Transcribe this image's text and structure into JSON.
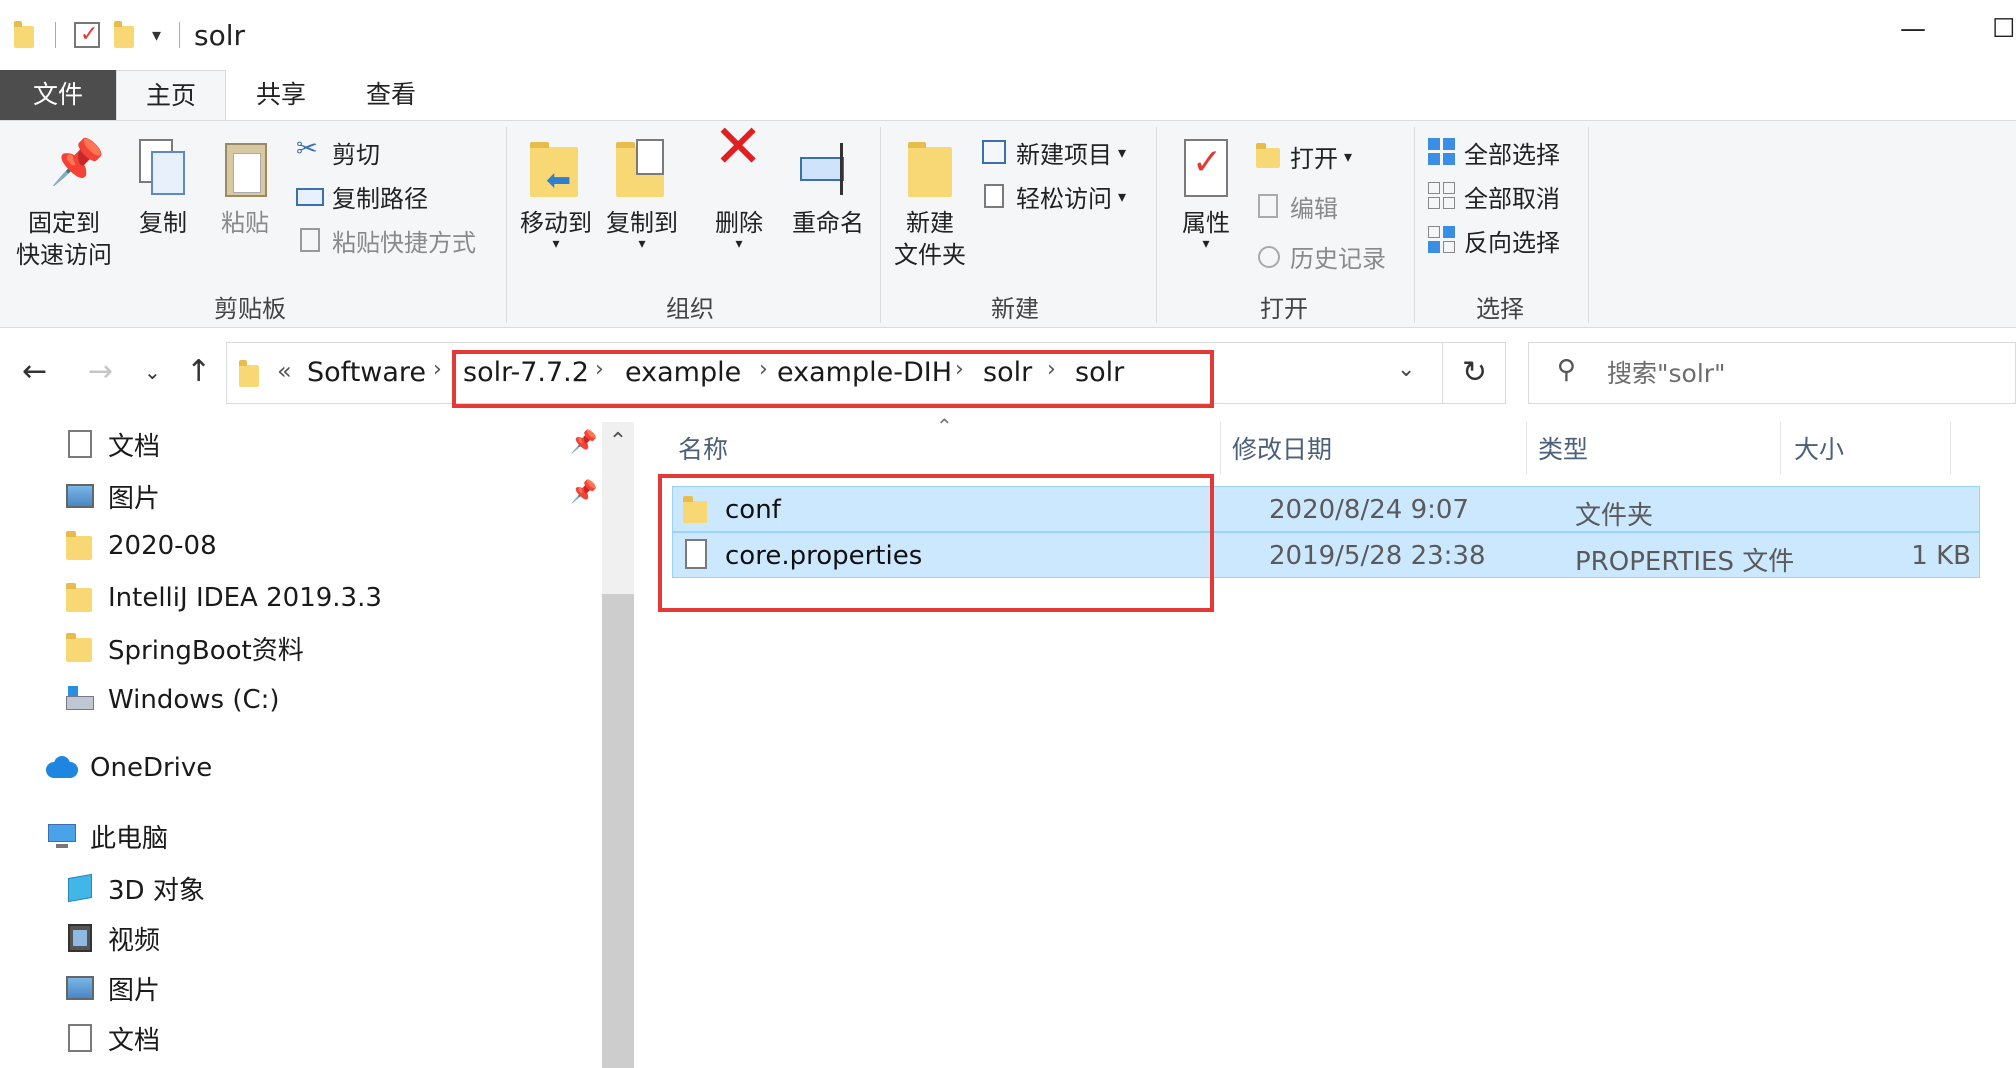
{
  "window": {
    "title": "solr",
    "minimize": "—",
    "maximize": "☐"
  },
  "tabs": [
    {
      "label": "文件"
    },
    {
      "label": "主页"
    },
    {
      "label": "共享"
    },
    {
      "label": "查看"
    }
  ],
  "ribbon": {
    "clipboard": {
      "group": "剪贴板",
      "pin_line1": "固定到",
      "pin_line2": "快速访问",
      "copy": "复制",
      "paste": "粘贴",
      "cut": "剪切",
      "copy_path": "复制路径",
      "paste_shortcut": "粘贴快捷方式"
    },
    "organize": {
      "group": "组织",
      "move_to": "移动到",
      "copy_to": "复制到",
      "delete": "删除",
      "rename": "重命名"
    },
    "new": {
      "group": "新建",
      "new_folder_line1": "新建",
      "new_folder_line2": "文件夹",
      "new_item": "新建项目",
      "easy_access": "轻松访问"
    },
    "open": {
      "group": "打开",
      "properties": "属性",
      "open": "打开",
      "edit": "编辑",
      "history": "历史记录"
    },
    "select": {
      "group": "选择",
      "select_all": "全部选择",
      "select_none": "全部取消",
      "invert": "反向选择"
    }
  },
  "address": {
    "overflow": "«",
    "crumbs": [
      "Software",
      "solr-7.7.2",
      "example",
      "example-DIH",
      "solr",
      "solr"
    ],
    "sep": "›"
  },
  "search": {
    "placeholder": "搜索\"solr\""
  },
  "nav": {
    "items": [
      {
        "label": "文档"
      },
      {
        "label": "图片"
      },
      {
        "label": "2020-08"
      },
      {
        "label": "IntelliJ IDEA 2019.3.3"
      },
      {
        "label": "SpringBoot资料"
      },
      {
        "label": "Windows (C:)"
      },
      {
        "label": "OneDrive"
      },
      {
        "label": "此电脑"
      },
      {
        "label": "3D 对象"
      },
      {
        "label": "视频"
      },
      {
        "label": "图片"
      },
      {
        "label": "文档"
      }
    ]
  },
  "columns": {
    "name": "名称",
    "date": "修改日期",
    "type": "类型",
    "size": "大小"
  },
  "files": [
    {
      "name": "conf",
      "date": "2020/8/24 9:07",
      "type": "文件夹",
      "size": ""
    },
    {
      "name": "core.properties",
      "date": "2019/5/28 23:38",
      "type": "PROPERTIES 文件",
      "size": "1 KB"
    }
  ],
  "colors": {
    "selection": "#cce8ff",
    "highlight": "#e53935",
    "folder": "#f8d775"
  }
}
